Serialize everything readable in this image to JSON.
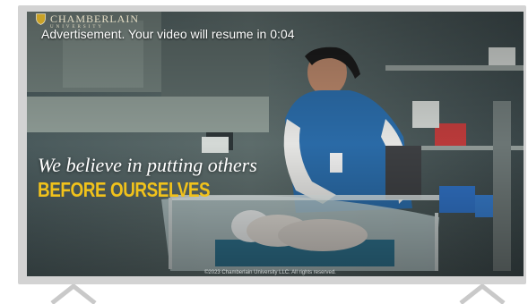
{
  "ad": {
    "message": "Advertisement. Your video will resume in 0:04",
    "brand_name": "CHAMBERLAIN",
    "brand_sub": "UNIVERSITY",
    "tagline_line1": "We believe in putting others",
    "tagline_line2": "BEFORE OURSELVES",
    "copyright": "©2023 Chamberlain University LLC. All rights reserved."
  },
  "colors": {
    "frame": "#d3d3d3",
    "tagline_accent": "#f1c21b",
    "scrubs": "#2a6aa6"
  },
  "icons": {
    "shield": "shield-icon",
    "prev": "chevron-up-icon",
    "next": "chevron-up-icon"
  }
}
